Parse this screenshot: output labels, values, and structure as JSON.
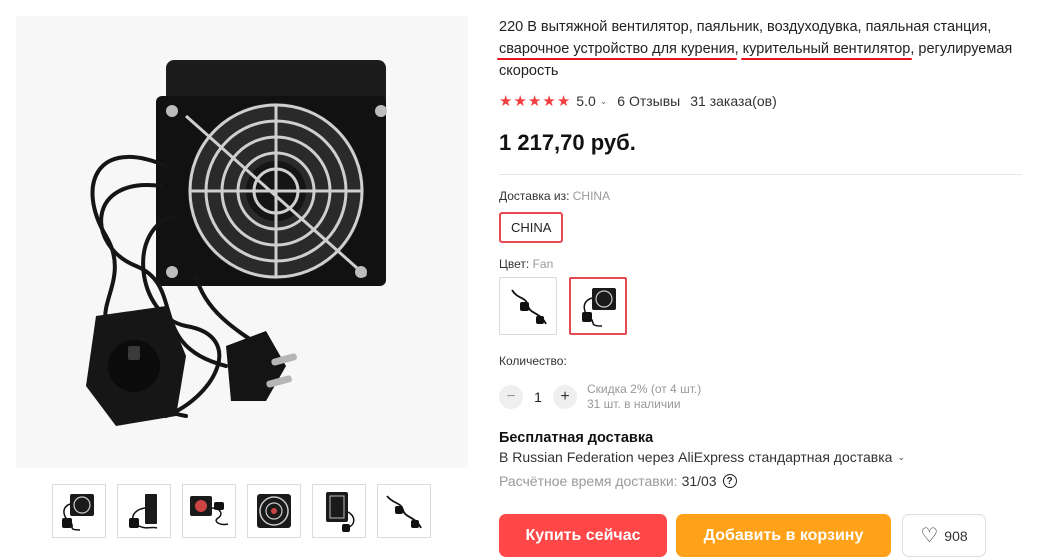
{
  "product": {
    "title_part1": "220 В вытяжной вентилятор, паяльник, воздуходувка, паяльная станция, ",
    "title_highlight1": "сварочное устройство для курения",
    "title_sep": ", ",
    "title_highlight2": "курительный вентилятор",
    "title_part2": ", регулируемая скорость",
    "rating": "5.0",
    "reviews": "6 Отзывы",
    "orders": "31 заказа(ов)",
    "price": "1 217,70 руб."
  },
  "shipping_from": {
    "label": "Доставка из:",
    "value": "CHINA",
    "option": "CHINA"
  },
  "color": {
    "label": "Цвет:",
    "value": "Fan"
  },
  "quantity": {
    "label": "Количество:",
    "minus": "−",
    "value": "1",
    "plus": "+",
    "discount_note": "Скидка 2% (от 4 шт.)",
    "stock_note": "31 шт. в наличии"
  },
  "delivery": {
    "free_label": "Бесплатная доставка",
    "via": "В Russian Federation через AliExpress стандартная доставка",
    "eta_label": "Расчётное время доставки:",
    "eta_date": "31/03",
    "help": "?"
  },
  "actions": {
    "buy_now": "Купить сейчас",
    "add_to_cart": "Добавить в корзину",
    "wishlist_count": "908"
  },
  "icons": {
    "star": "★",
    "chevron": "⌄",
    "heart": "♡"
  },
  "colors": {
    "accent_red": "#ff4747",
    "accent_orange": "#ffa21a",
    "star_red": "#f23e3e",
    "highlight_underline": "#e8141e"
  }
}
